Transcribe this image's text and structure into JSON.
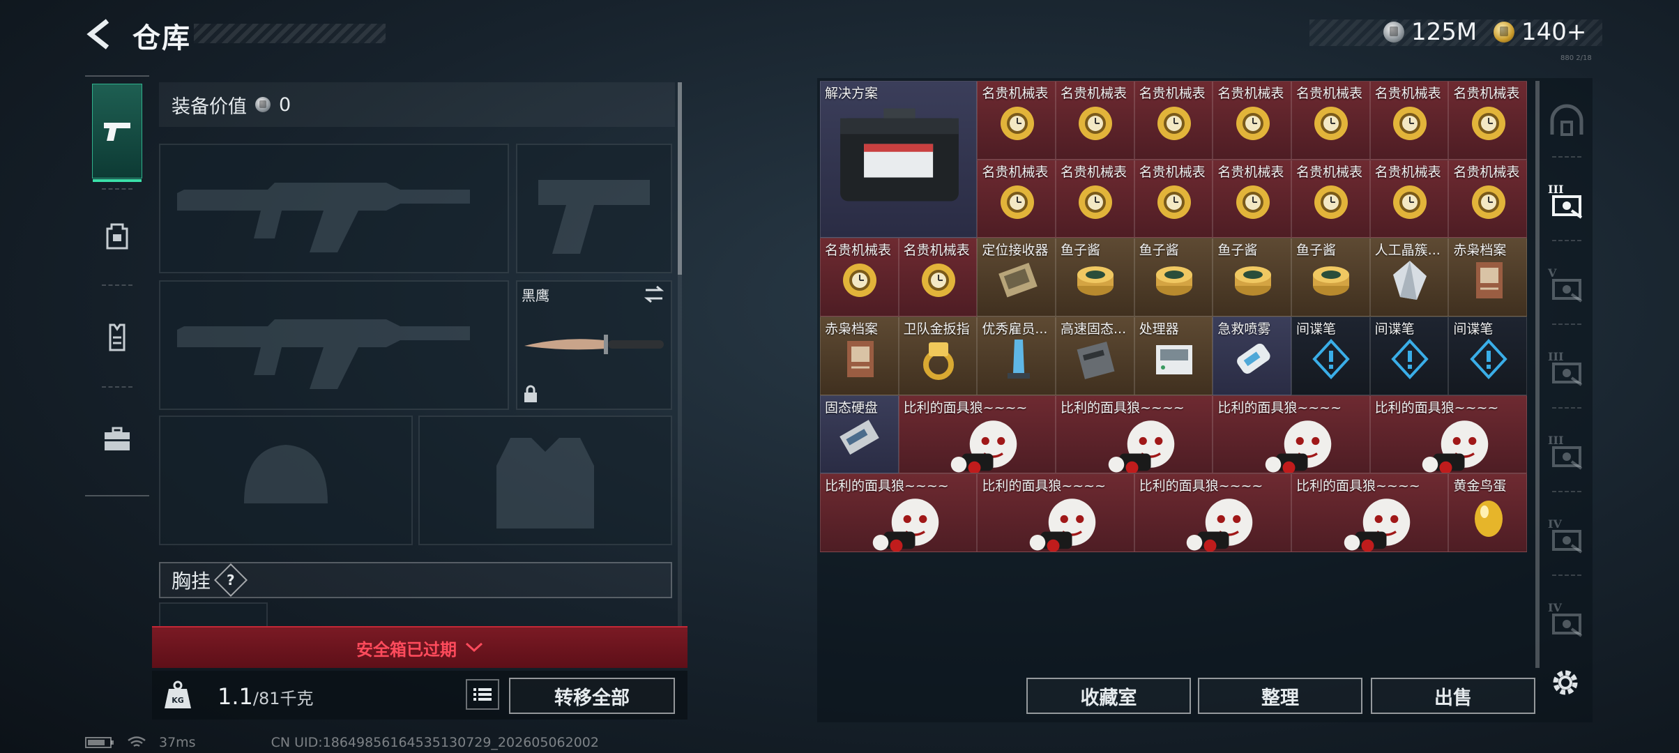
{
  "header": {
    "title": "仓库",
    "currencies": [
      {
        "icon": "silver-coin-icon",
        "value": "125M"
      },
      {
        "icon": "gold-coin-icon",
        "value": "140+"
      }
    ],
    "tiny_label": "880 2/18"
  },
  "left_nav": {
    "items": [
      {
        "name": "weapon-tab",
        "icon": "pistol-icon",
        "active": true
      },
      {
        "name": "backpack-tab",
        "icon": "backpack-icon",
        "active": false
      },
      {
        "name": "armor-tab",
        "icon": "vest-icon",
        "active": false
      },
      {
        "name": "case-tab",
        "icon": "briefcase-icon",
        "active": false
      }
    ]
  },
  "loadout": {
    "equip_value_label": "装备价值",
    "equip_value": "0",
    "melee_name": "黑鹰",
    "chest_rig_label": "胸挂",
    "chest_rig_help": "?",
    "safe_box_expired": "安全箱已过期",
    "weight_current": "1.1",
    "weight_max": "/81千克",
    "transfer_all": "转移全部"
  },
  "status_bar": {
    "ping": "37ms",
    "uid": "CN UID:1864985616453513072​9_202605062002"
  },
  "stash": {
    "items": [
      {
        "label": "解决方案",
        "col": 0,
        "row": 0,
        "w": 2,
        "h": 2,
        "rarity": "purple",
        "icon": "toolbox-icon"
      },
      {
        "label": "名贵机械表",
        "col": 2,
        "row": 0,
        "w": 1,
        "h": 1,
        "rarity": "red",
        "icon": "gold-watch-icon"
      },
      {
        "label": "名贵机械表",
        "col": 3,
        "row": 0,
        "w": 1,
        "h": 1,
        "rarity": "red",
        "icon": "gold-watch-icon"
      },
      {
        "label": "名贵机械表",
        "col": 4,
        "row": 0,
        "w": 1,
        "h": 1,
        "rarity": "red",
        "icon": "gold-watch-icon"
      },
      {
        "label": "名贵机械表",
        "col": 5,
        "row": 0,
        "w": 1,
        "h": 1,
        "rarity": "red",
        "icon": "gold-watch-icon"
      },
      {
        "label": "名贵机械表",
        "col": 6,
        "row": 0,
        "w": 1,
        "h": 1,
        "rarity": "red",
        "icon": "gold-watch-icon"
      },
      {
        "label": "名贵机械表",
        "col": 7,
        "row": 0,
        "w": 1,
        "h": 1,
        "rarity": "red",
        "icon": "gold-watch-icon"
      },
      {
        "label": "名贵机械表",
        "col": 8,
        "row": 0,
        "w": 1,
        "h": 1,
        "rarity": "red",
        "icon": "gold-watch-icon"
      },
      {
        "label": "名贵机械表",
        "col": 2,
        "row": 1,
        "w": 1,
        "h": 1,
        "rarity": "red",
        "icon": "gold-watch-icon"
      },
      {
        "label": "名贵机械表",
        "col": 3,
        "row": 1,
        "w": 1,
        "h": 1,
        "rarity": "red",
        "icon": "gold-watch-icon"
      },
      {
        "label": "名贵机械表",
        "col": 4,
        "row": 1,
        "w": 1,
        "h": 1,
        "rarity": "red",
        "icon": "gold-watch-icon"
      },
      {
        "label": "名贵机械表",
        "col": 5,
        "row": 1,
        "w": 1,
        "h": 1,
        "rarity": "red",
        "icon": "gold-watch-icon"
      },
      {
        "label": "名贵机械表",
        "col": 6,
        "row": 1,
        "w": 1,
        "h": 1,
        "rarity": "red",
        "icon": "gold-watch-icon"
      },
      {
        "label": "名贵机械表",
        "col": 7,
        "row": 1,
        "w": 1,
        "h": 1,
        "rarity": "red",
        "icon": "gold-watch-icon"
      },
      {
        "label": "名贵机械表",
        "col": 8,
        "row": 1,
        "w": 1,
        "h": 1,
        "rarity": "red",
        "icon": "gold-watch-icon"
      },
      {
        "label": "名贵机械表",
        "col": 0,
        "row": 2,
        "w": 1,
        "h": 1,
        "rarity": "red",
        "icon": "gold-watch-icon"
      },
      {
        "label": "名贵机械表",
        "col": 1,
        "row": 2,
        "w": 1,
        "h": 1,
        "rarity": "red",
        "icon": "gold-watch-icon"
      },
      {
        "label": "定位接收器",
        "col": 2,
        "row": 2,
        "w": 1,
        "h": 1,
        "rarity": "gold",
        "icon": "receiver-icon"
      },
      {
        "label": "鱼子酱",
        "col": 3,
        "row": 2,
        "w": 1,
        "h": 1,
        "rarity": "gold",
        "icon": "caviar-tin-icon"
      },
      {
        "label": "鱼子酱",
        "col": 4,
        "row": 2,
        "w": 1,
        "h": 1,
        "rarity": "gold",
        "icon": "caviar-tin-icon"
      },
      {
        "label": "鱼子酱",
        "col": 5,
        "row": 2,
        "w": 1,
        "h": 1,
        "rarity": "gold",
        "icon": "caviar-tin-icon"
      },
      {
        "label": "鱼子酱",
        "col": 6,
        "row": 2,
        "w": 1,
        "h": 1,
        "rarity": "gold",
        "icon": "caviar-tin-icon"
      },
      {
        "label": "人工晶簇...",
        "col": 7,
        "row": 2,
        "w": 1,
        "h": 1,
        "rarity": "gold",
        "icon": "crystal-icon"
      },
      {
        "label": "赤枭档案",
        "col": 8,
        "row": 2,
        "w": 1,
        "h": 1,
        "rarity": "gold",
        "icon": "dossier-icon"
      },
      {
        "label": "赤枭档案",
        "col": 0,
        "row": 3,
        "w": 1,
        "h": 1,
        "rarity": "gold",
        "icon": "dossier-icon"
      },
      {
        "label": "卫队金扳指",
        "col": 1,
        "row": 3,
        "w": 1,
        "h": 1,
        "rarity": "gold",
        "icon": "gold-ring-icon"
      },
      {
        "label": "优秀雇员...",
        "col": 2,
        "row": 3,
        "w": 1,
        "h": 1,
        "rarity": "gold",
        "icon": "trophy-icon"
      },
      {
        "label": "高速固态...",
        "col": 3,
        "row": 3,
        "w": 1,
        "h": 1,
        "rarity": "gold",
        "icon": "ssd-icon"
      },
      {
        "label": "处理器",
        "col": 4,
        "row": 3,
        "w": 1,
        "h": 1,
        "rarity": "gold",
        "icon": "processor-icon"
      },
      {
        "label": "急救喷雾",
        "col": 5,
        "row": 3,
        "w": 1,
        "h": 1,
        "rarity": "purple",
        "icon": "spray-icon"
      },
      {
        "label": "间谍笔",
        "col": 6,
        "row": 3,
        "w": 1,
        "h": 1,
        "rarity": "dark",
        "icon": "spy-pen-icon"
      },
      {
        "label": "间谍笔",
        "col": 7,
        "row": 3,
        "w": 1,
        "h": 1,
        "rarity": "dark",
        "icon": "spy-pen-icon"
      },
      {
        "label": "间谍笔",
        "col": 8,
        "row": 3,
        "w": 1,
        "h": 1,
        "rarity": "dark",
        "icon": "spy-pen-icon"
      },
      {
        "label": "固态硬盘",
        "col": 0,
        "row": 4,
        "w": 1,
        "h": 1,
        "rarity": "purple",
        "icon": "ssd-card-icon"
      },
      {
        "label": "比利的面具狼~~~~",
        "col": 1,
        "row": 4,
        "w": 2,
        "h": 1,
        "rarity": "red",
        "icon": "puppet-icon"
      },
      {
        "label": "比利的面具狼~~~~",
        "col": 3,
        "row": 4,
        "w": 2,
        "h": 1,
        "rarity": "red",
        "icon": "puppet-icon"
      },
      {
        "label": "比利的面具狼~~~~",
        "col": 5,
        "row": 4,
        "w": 2,
        "h": 1,
        "rarity": "red",
        "icon": "puppet-icon"
      },
      {
        "label": "比利的面具狼~~~~",
        "col": 7,
        "row": 4,
        "w": 2,
        "h": 1,
        "rarity": "red",
        "icon": "puppet-icon"
      },
      {
        "label": "比利的面具狼~~~~",
        "col": 0,
        "row": 5,
        "w": 2,
        "h": 1,
        "rarity": "red",
        "icon": "puppet-icon"
      },
      {
        "label": "比利的面具狼~~~~",
        "col": 2,
        "row": 5,
        "w": 2,
        "h": 1,
        "rarity": "red",
        "icon": "puppet-icon"
      },
      {
        "label": "比利的面具狼~~~~",
        "col": 4,
        "row": 5,
        "w": 2,
        "h": 1,
        "rarity": "red",
        "icon": "puppet-icon"
      },
      {
        "label": "比利的面具狼~~~~",
        "col": 6,
        "row": 5,
        "w": 2,
        "h": 1,
        "rarity": "red",
        "icon": "puppet-icon"
      },
      {
        "label": "黄金鸟蛋",
        "col": 8,
        "row": 5,
        "w": 1,
        "h": 1,
        "rarity": "red",
        "icon": "golden-egg-icon"
      }
    ]
  },
  "right_nav": {
    "items": [
      {
        "icon": "stash-home-icon",
        "roman": ""
      },
      {
        "icon": "tier-case-icon",
        "roman": "III"
      },
      {
        "icon": "tier-case-icon",
        "roman": "V"
      },
      {
        "icon": "tier-case-icon",
        "roman": "III"
      },
      {
        "icon": "tier-case-icon",
        "roman": "III"
      },
      {
        "icon": "tier-case-icon",
        "roman": "IV"
      },
      {
        "icon": "tier-case-icon",
        "roman": "IV"
      }
    ]
  },
  "actions": {
    "collection": "收藏室",
    "sort": "整理",
    "sell": "出售"
  }
}
